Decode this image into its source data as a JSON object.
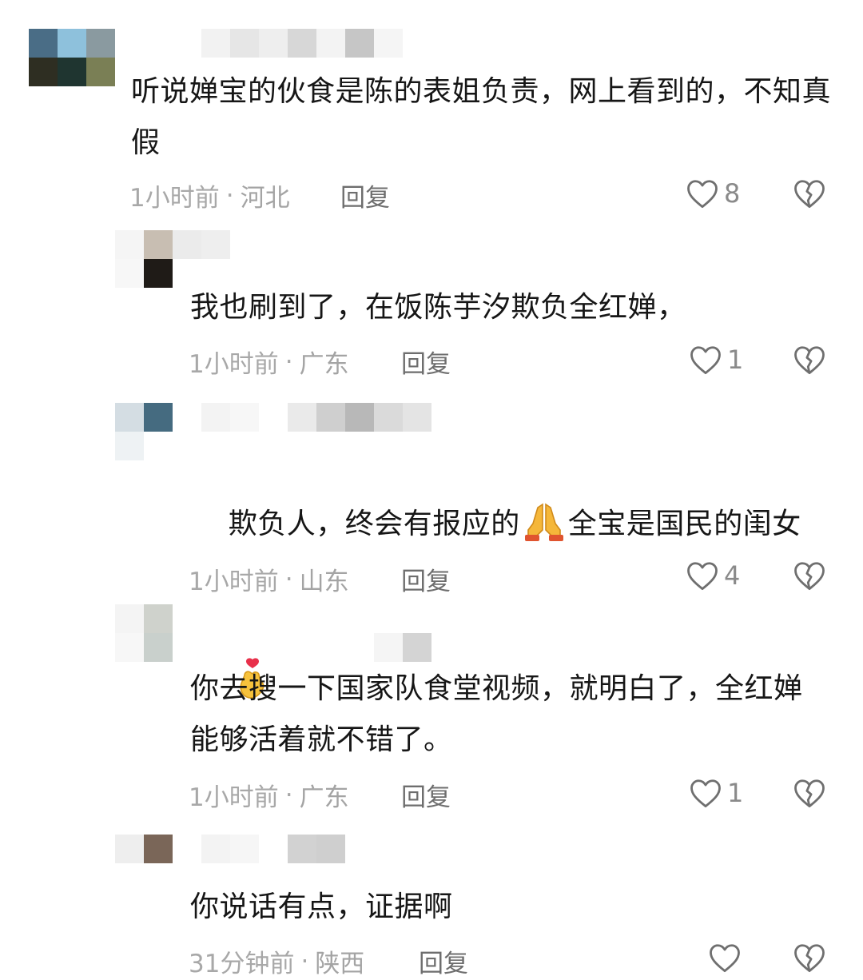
{
  "comments": [
    {
      "text": "听说婵宝的伙食是陈的表姐负责，网上看到的，不知真假",
      "time": "1小时前",
      "location": "河北",
      "reply_label": "回复",
      "likes": "8",
      "avatar_colors": [
        "#4a6d86",
        "#8ec1dc",
        "#8a9aa0",
        "#2e2e22",
        "#1f3530",
        "#7a7f55"
      ],
      "name_colors": [
        "#f2f2f2",
        "#e6e6e6",
        "#eeeeee",
        "#d7d7d7",
        "#f3f3f3",
        "#c6c6c6",
        "#f5f5f5"
      ]
    },
    {
      "text": "我也刷到了，在饭陈芋汐欺负全红婵，",
      "time": "1小时前",
      "location": "广东",
      "reply_label": "回复",
      "likes": "1",
      "avatar_colors": [
        "#f5f5f5",
        "#c8beb2",
        "#f7f7f7",
        "#1f1b17"
      ],
      "name_colors": [
        "#ebebeb",
        "#eeeeee"
      ]
    },
    {
      "text_before_emoji": "欺负人，终会有报应的",
      "text_after_emoji": "全宝是国民的闺女",
      "time": "1小时前",
      "location": "山东",
      "reply_label": "回复",
      "likes": "4",
      "avatar_colors": [
        "#d4dde3",
        "#456b80",
        "#eef2f4",
        "#ffffff"
      ],
      "name_colors": [
        "#f3f3f3",
        "#f7f7f7",
        "#eaeaea",
        "#cfcfcf",
        "#b8b8b8",
        "#dadada",
        "#e4e4e4",
        "#d0d0d0"
      ]
    },
    {
      "text": "你去搜一下国家队食堂视频，就明白了，全红婵能够活着就不错了。",
      "time": "1小时前",
      "location": "广东",
      "reply_label": "回复",
      "likes": "1",
      "avatar_colors": [
        "#f4f4f4",
        "#cfd2cc",
        "#f7f7f7",
        "#c9d0cc"
      ],
      "name_colors": [
        "#f5f5f5",
        "#f7f7f7",
        "#eeeeee",
        "#d4d4d4"
      ]
    },
    {
      "text": "你说话有点，证据啊",
      "time": "31分钟前",
      "location": "陕西",
      "reply_label": "回复",
      "likes": "",
      "avatar_colors": [
        "#eeeeee",
        "#7a6658",
        "#ffffff",
        "#ffffff"
      ],
      "name_colors": [
        "#f3f3f3",
        "#f6f6f6",
        "#d2d2d2",
        "#cfcfcf"
      ]
    }
  ],
  "colors": {
    "meta_text": "#a8a8a8",
    "reply_text": "#6e6e6e",
    "icon_stroke": "#6f6f6f"
  },
  "icons": {
    "like": "heart-outline-icon",
    "dislike": "broken-heart-outline-icon",
    "emoji_1": "folded-hands-emoji",
    "emoji_2": "finger-heart-emoji"
  }
}
